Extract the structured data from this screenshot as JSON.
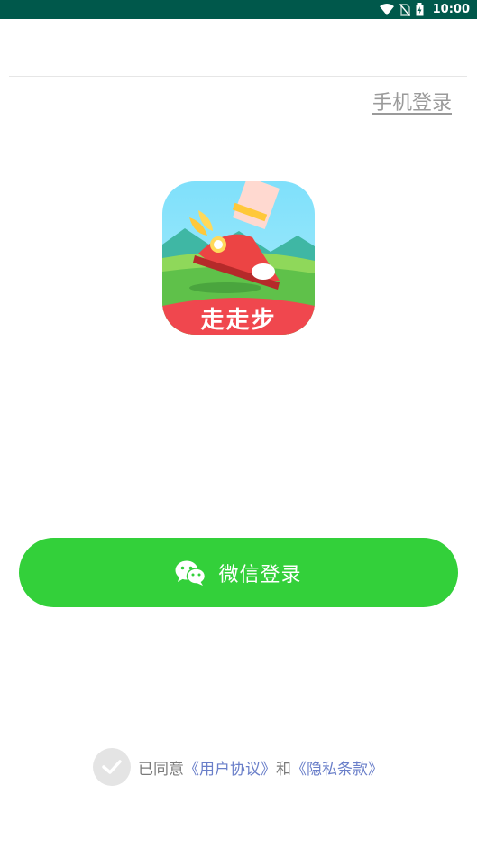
{
  "status_bar": {
    "time": "10:00",
    "icons": [
      "wifi-icon",
      "no-sim-icon",
      "battery-charging-icon"
    ]
  },
  "header": {
    "phone_login_label": "手机登录"
  },
  "logo": {
    "text": "走走步"
  },
  "wechat_button": {
    "label": "微信登录",
    "icon": "wechat-icon"
  },
  "agreement": {
    "prefix": "已同意",
    "user_agreement": "《用户协议》",
    "conjunction": "和",
    "privacy_policy": "《隐私条款》"
  },
  "colors": {
    "status_bar": "#00584b",
    "button_green": "#33d03a",
    "link_blue": "#6a7fc9",
    "logo_red": "#f0474e"
  }
}
